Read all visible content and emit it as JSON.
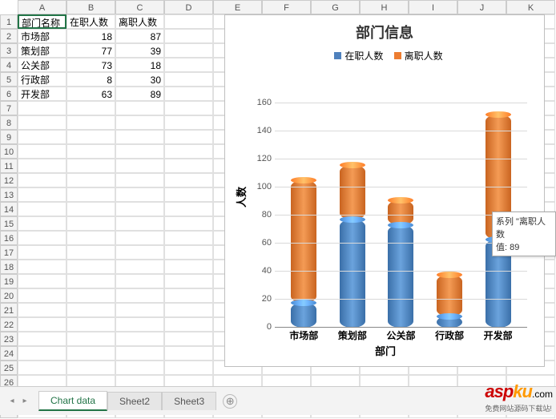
{
  "columns": [
    "A",
    "B",
    "C",
    "D",
    "E",
    "F",
    "G",
    "H",
    "I",
    "J",
    "K"
  ],
  "row_count": 28,
  "table": {
    "headers": [
      "部门名称",
      "在职人数",
      "离职人数"
    ],
    "rows": [
      {
        "dept": "市场部",
        "on": 18,
        "off": 87
      },
      {
        "dept": "策划部",
        "on": 77,
        "off": 39
      },
      {
        "dept": "公关部",
        "on": 73,
        "off": 18
      },
      {
        "dept": "行政部",
        "on": 8,
        "off": 30
      },
      {
        "dept": "开发部",
        "on": 63,
        "off": 89
      }
    ]
  },
  "chart_data": {
    "type": "bar",
    "stacked": true,
    "title": "部门信息",
    "xlabel": "部门",
    "ylabel": "人数",
    "ylim": [
      0,
      160
    ],
    "yticks": [
      0,
      20,
      40,
      60,
      80,
      100,
      120,
      140,
      160
    ],
    "categories": [
      "市场部",
      "策划部",
      "公关部",
      "行政部",
      "开发部"
    ],
    "series": [
      {
        "name": "在职人数",
        "color": "#4f81bd",
        "values": [
          18,
          77,
          73,
          8,
          63
        ]
      },
      {
        "name": "离职人数",
        "color": "#ed7d31",
        "values": [
          87,
          39,
          18,
          30,
          89
        ]
      }
    ],
    "legend_position": "top"
  },
  "tooltip": {
    "line1": "系列 \"离职人数",
    "line2": "值: 89"
  },
  "tabs": {
    "active": "Chart data",
    "others": [
      "Sheet2",
      "Sheet3"
    ]
  },
  "watermark": {
    "brand": "aspku",
    "tld": ".com",
    "sub": "免费网站源码下载站!"
  }
}
